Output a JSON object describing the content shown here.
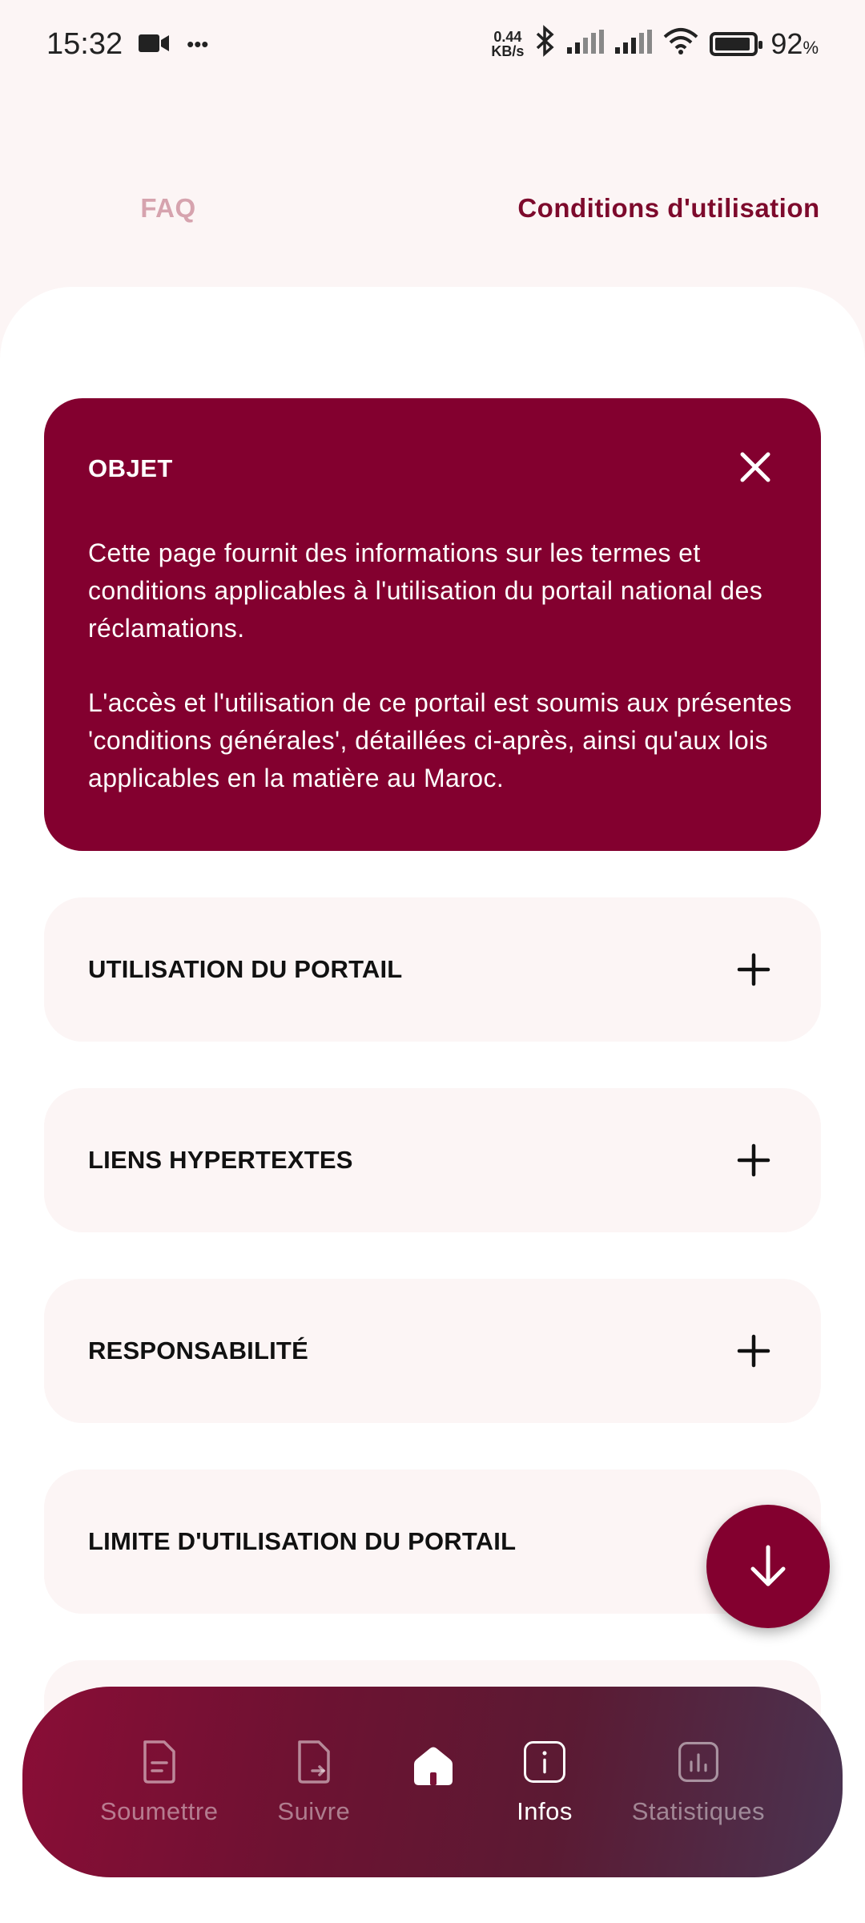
{
  "status_bar": {
    "time": "15:32",
    "more": "•••",
    "net_speed_value": "0.44",
    "net_speed_unit": "KB/s",
    "battery_percent": "92",
    "battery_fill": 0.92
  },
  "tabs": {
    "faq": "FAQ",
    "conditions": "Conditions d'utilisation"
  },
  "objet": {
    "title": "OBJET",
    "paragraph1": "Cette page fournit des informations sur les termes et conditions applicables à l'utilisation du portail national des réclamations.",
    "paragraph2": "L'accès et l'utilisation de ce portail est soumis aux présentes 'conditions générales', détaillées ci-après, ainsi qu'aux lois applicables en la matière au Maroc."
  },
  "accordion": [
    {
      "label": "UTILISATION DU PORTAIL"
    },
    {
      "label": "LIENS HYPERTEXTES"
    },
    {
      "label": "RESPONSABILITÉ"
    },
    {
      "label": "LIMITE D'UTILISATION DU PORTAIL"
    }
  ],
  "bottom_nav": {
    "soumettre": "Soumettre",
    "suivre": "Suivre",
    "infos": "Infos",
    "statistiques": "Statistiques"
  },
  "colors": {
    "brand": "#83002f",
    "tab_inactive": "#d6a3ae",
    "card_bg": "#fcf5f5"
  }
}
